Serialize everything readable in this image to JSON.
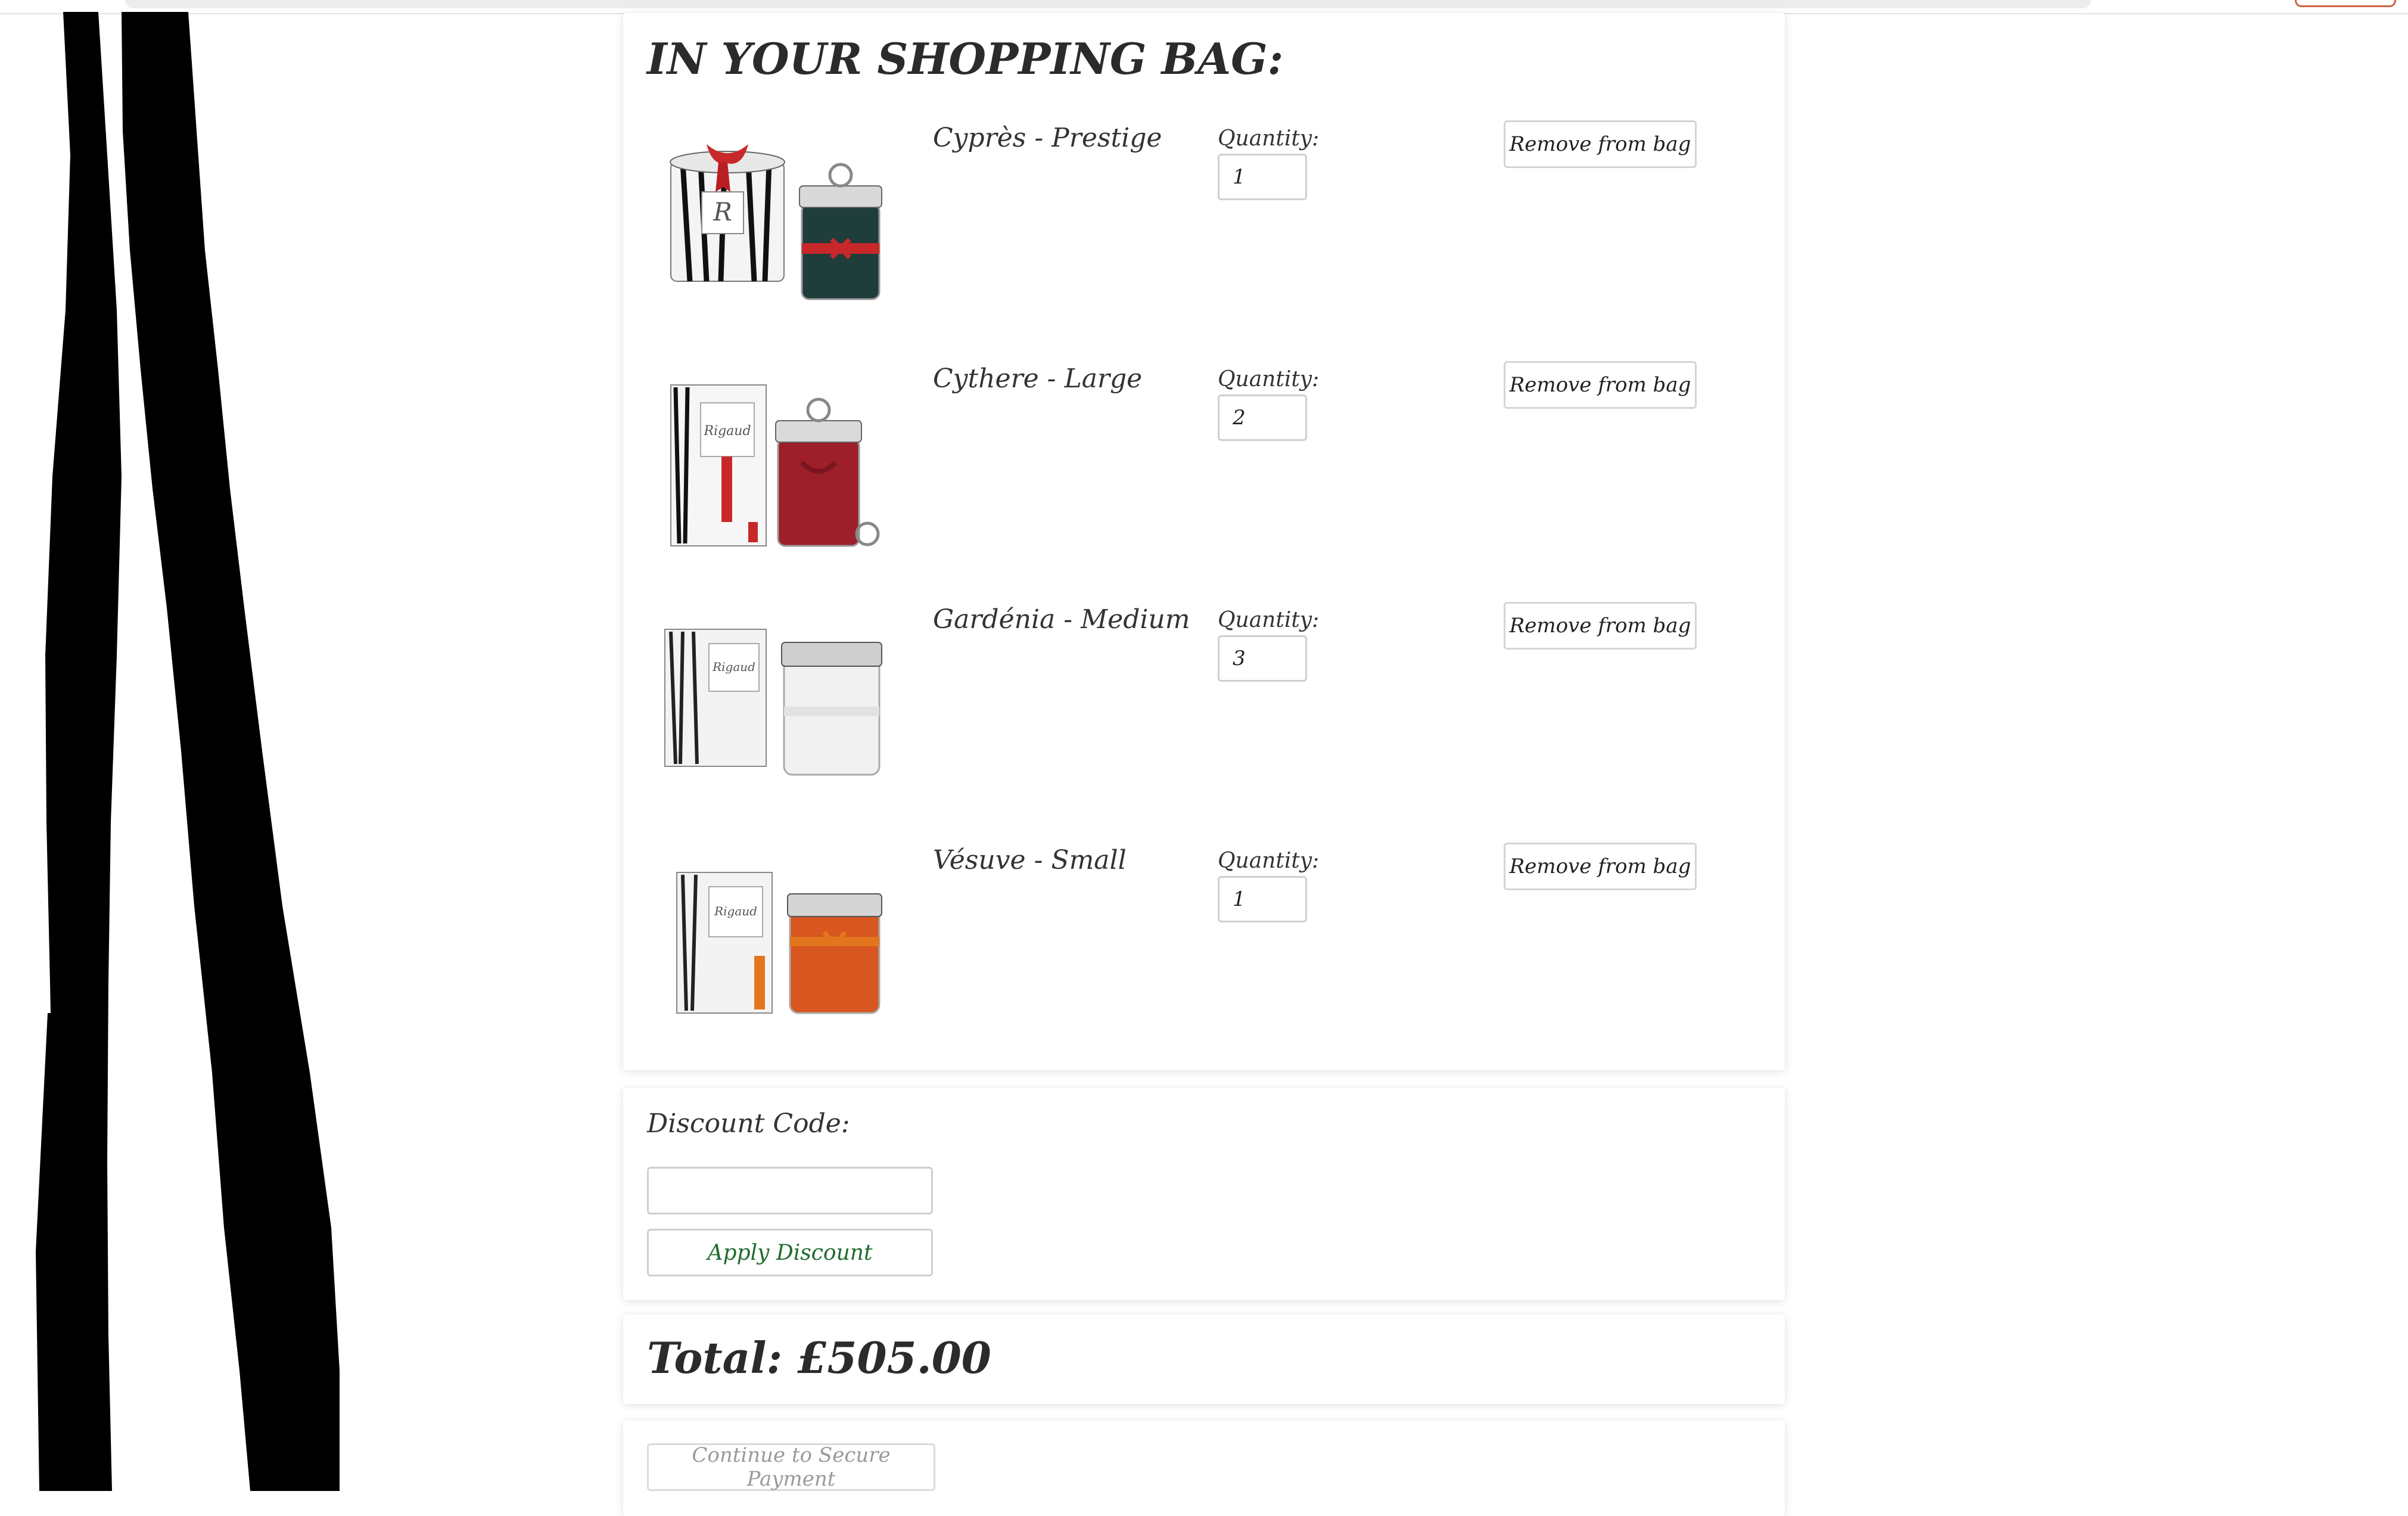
{
  "bag": {
    "title": "IN YOUR SHOPPING BAG:",
    "quantity_label": "Quantity:",
    "remove_label": "Remove from bag",
    "items": [
      {
        "name": "Cyprès - Prestige",
        "quantity": "1",
        "ribbon_color": "#c8282a",
        "candle_color": "#1f3d3b",
        "box_style": "round-stripes"
      },
      {
        "name": "Cythere - Large",
        "quantity": "2",
        "ribbon_color": "#c8282a",
        "candle_color": "#9c1f2a",
        "box_style": "flat-box"
      },
      {
        "name": "Gardénia - Medium",
        "quantity": "3",
        "ribbon_color": "#e8e8e8",
        "candle_color": "#f1f1f1",
        "box_style": "flat-box"
      },
      {
        "name": "Vésuve - Small",
        "quantity": "1",
        "ribbon_color": "#e2761f",
        "candle_color": "#d8561f",
        "box_style": "flat-box"
      }
    ]
  },
  "discount": {
    "label": "Discount Code:",
    "input_value": "",
    "apply_label": "Apply Discount"
  },
  "total": {
    "text": "Total: £505.00"
  },
  "payment": {
    "button_label": "Continue to Secure Payment"
  },
  "colors": {
    "stripe": "#000000",
    "apply_text": "#1f6b2e",
    "disabled_text": "#9a9a9a"
  }
}
